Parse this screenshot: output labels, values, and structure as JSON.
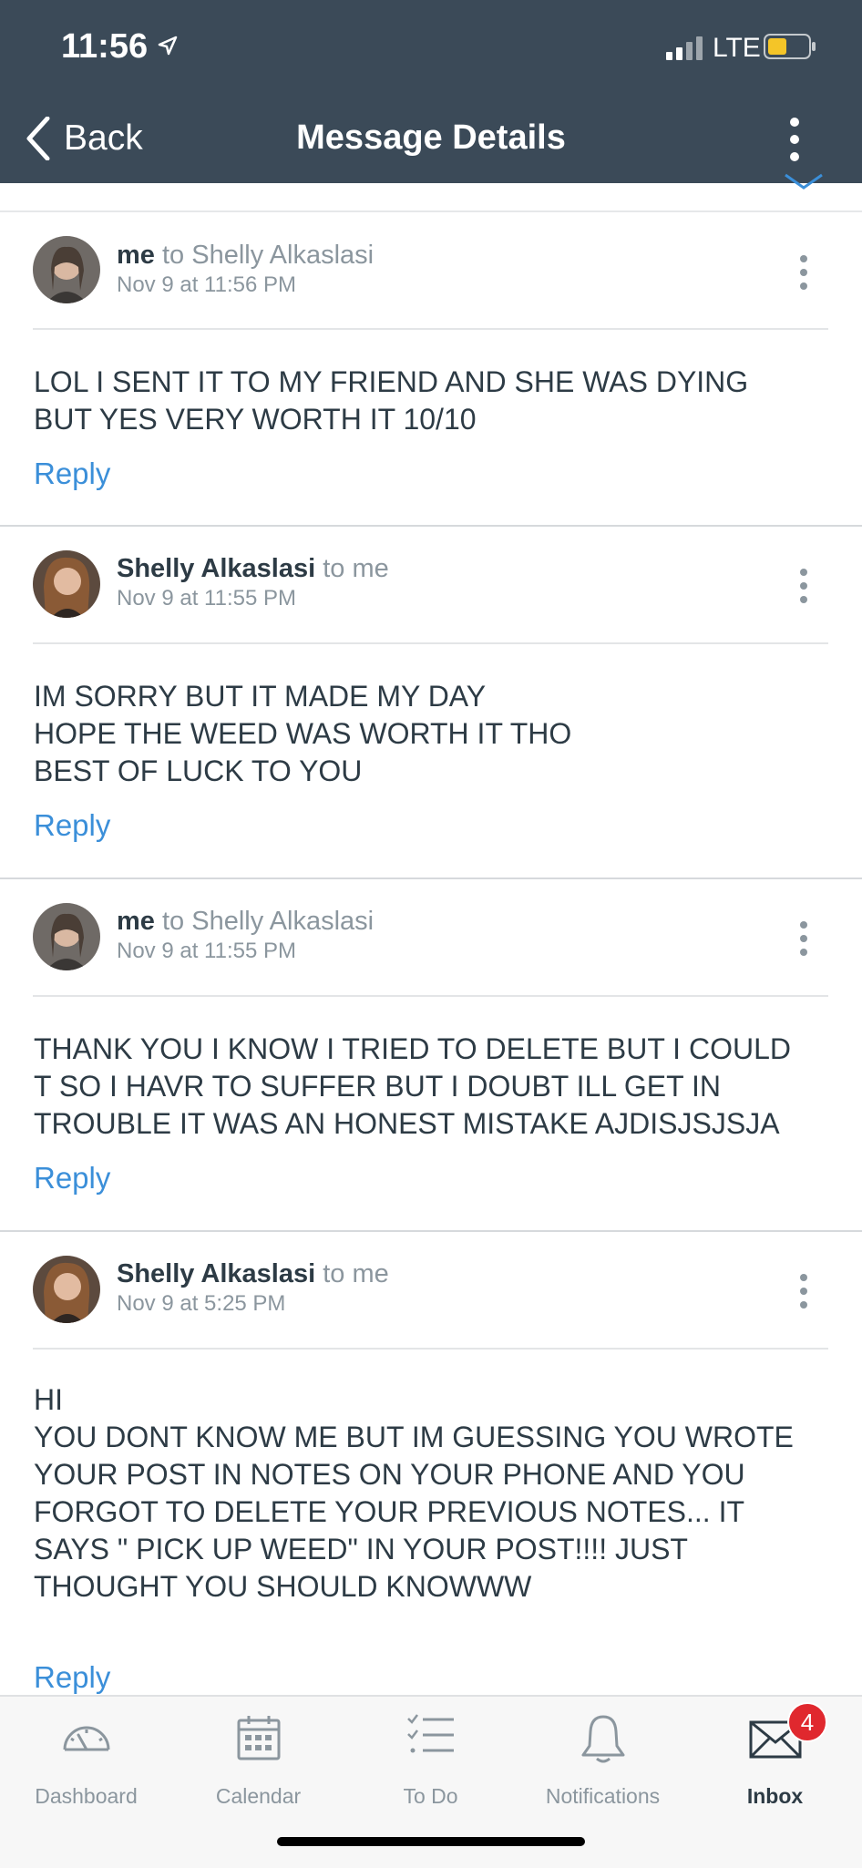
{
  "status": {
    "time": "11:56",
    "network": "LTE"
  },
  "nav": {
    "back_label": "Back",
    "title": "Message Details"
  },
  "colors": {
    "nav_bg": "#3b4a58",
    "link": "#3b8fd9",
    "badge": "#e0282e"
  },
  "messages": [
    {
      "sender": "me",
      "to_text": "to Shelly Alkaslasi",
      "date": "Nov 9 at 11:56 PM",
      "body": [
        "LOL I SENT IT TO MY FRIEND AND SHE WAS DYING",
        "BUT YES VERY WORTH IT 10/10"
      ],
      "reply_label": "Reply"
    },
    {
      "sender": "Shelly Alkaslasi",
      "to_text": "to me",
      "date": "Nov 9 at 11:55 PM",
      "body": [
        "IM SORRY BUT IT MADE MY DAY",
        "HOPE THE WEED WAS WORTH IT THO",
        "BEST OF LUCK TO YOU"
      ],
      "reply_label": "Reply"
    },
    {
      "sender": "me",
      "to_text": "to Shelly Alkaslasi",
      "date": "Nov 9 at 11:55 PM",
      "body": [
        "THANK YOU I KNOW I TRIED TO DELETE BUT I COULD",
        "T SO I HAVR TO SUFFER BUT I DOUBT ILL GET IN",
        "TROUBLE IT WAS AN HONEST MISTAKE AJDISJSJSJA"
      ],
      "reply_label": "Reply"
    },
    {
      "sender": "Shelly Alkaslasi",
      "to_text": "to me",
      "date": "Nov 9 at 5:25 PM",
      "body": [
        "HI",
        "YOU DONT KNOW ME BUT IM GUESSING YOU WROTE",
        "YOUR POST IN NOTES ON YOUR PHONE AND YOU",
        "FORGOT TO DELETE YOUR PREVIOUS NOTES... IT",
        "SAYS \" PICK UP WEED\" IN YOUR POST!!!! JUST",
        "THOUGHT YOU SHOULD KNOWWW"
      ],
      "reply_label": "Reply"
    }
  ],
  "tabs": [
    {
      "label": "Dashboard",
      "icon": "dashboard-icon"
    },
    {
      "label": "Calendar",
      "icon": "calendar-icon"
    },
    {
      "label": "To Do",
      "icon": "todo-icon"
    },
    {
      "label": "Notifications",
      "icon": "bell-icon"
    },
    {
      "label": "Inbox",
      "icon": "inbox-icon",
      "badge": "4",
      "active": true
    }
  ]
}
